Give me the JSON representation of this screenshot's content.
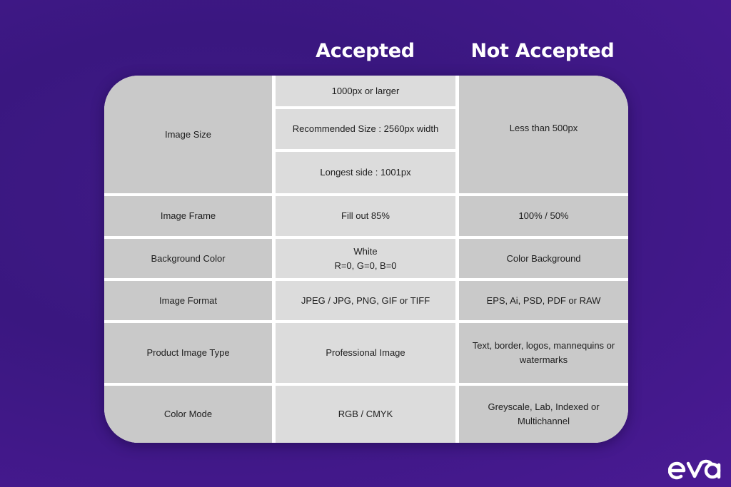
{
  "headers": {
    "accepted": "Accepted",
    "not_accepted": "Not Accepted"
  },
  "rows": [
    {
      "label": "Image Size",
      "accepted": [
        "1000px or larger",
        "Recommended Size : 2560px width",
        "Longest side : 1001px"
      ],
      "not_accepted": "Less than 500px"
    },
    {
      "label": "Image Frame",
      "accepted": "Fill out 85%",
      "not_accepted": "100% / 50%"
    },
    {
      "label": "Background Color",
      "accepted_line1": "White",
      "accepted_line2": "R=0, G=0, B=0",
      "not_accepted": "Color Background"
    },
    {
      "label": "Image Format",
      "accepted": "JPEG / JPG, PNG, GIF or TIFF",
      "not_accepted": "EPS, Ai, PSD, PDF or RAW"
    },
    {
      "label": "Product Image Type",
      "accepted": "Professional Image",
      "not_accepted": "Text, border, logos, mannequins or watermarks"
    },
    {
      "label": "Color Mode",
      "accepted": "RGB / CMYK",
      "not_accepted": "Greyscale, Lab, Indexed or Multichannel"
    }
  ],
  "brand": {
    "logo_icon": "eva-logo-icon",
    "name": "eva"
  },
  "colors": {
    "background": "#3d1884",
    "label_cell": "#c9c9c9",
    "accepted_cell": "#dcdcdc",
    "not_accepted_cell": "#c9c9c9",
    "grid_lines": "#ffffff",
    "heading_text": "#ffffff"
  }
}
